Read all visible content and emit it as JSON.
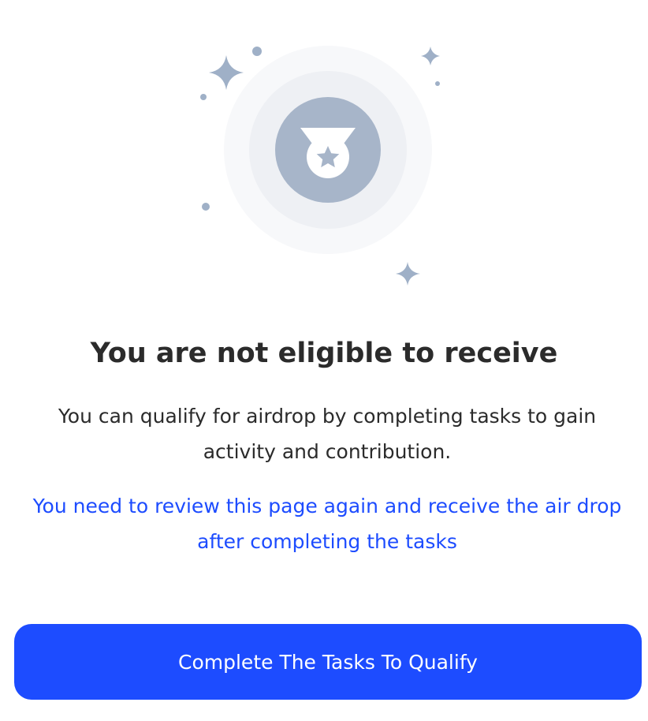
{
  "illustration": {
    "icon": "medal-icon",
    "decorations": [
      "sparkle-icon",
      "dot-icon"
    ],
    "colors": {
      "outer_ring": "#f7f8fa",
      "middle_ring": "#eef0f4",
      "badge": "#a7b5c9",
      "sparkle": "#9fb0c7"
    }
  },
  "main": {
    "title": "You are not eligible to receive",
    "description": "You can qualify for airdrop by completing tasks to gain activity and contribution.",
    "notice": "You need to review this page again and receive the air drop after completing the tasks"
  },
  "action": {
    "button_label": "Complete The Tasks To Qualify"
  },
  "colors": {
    "accent": "#1d4cff",
    "title_text": "#2b2b2b",
    "button_text": "#ffffff"
  }
}
